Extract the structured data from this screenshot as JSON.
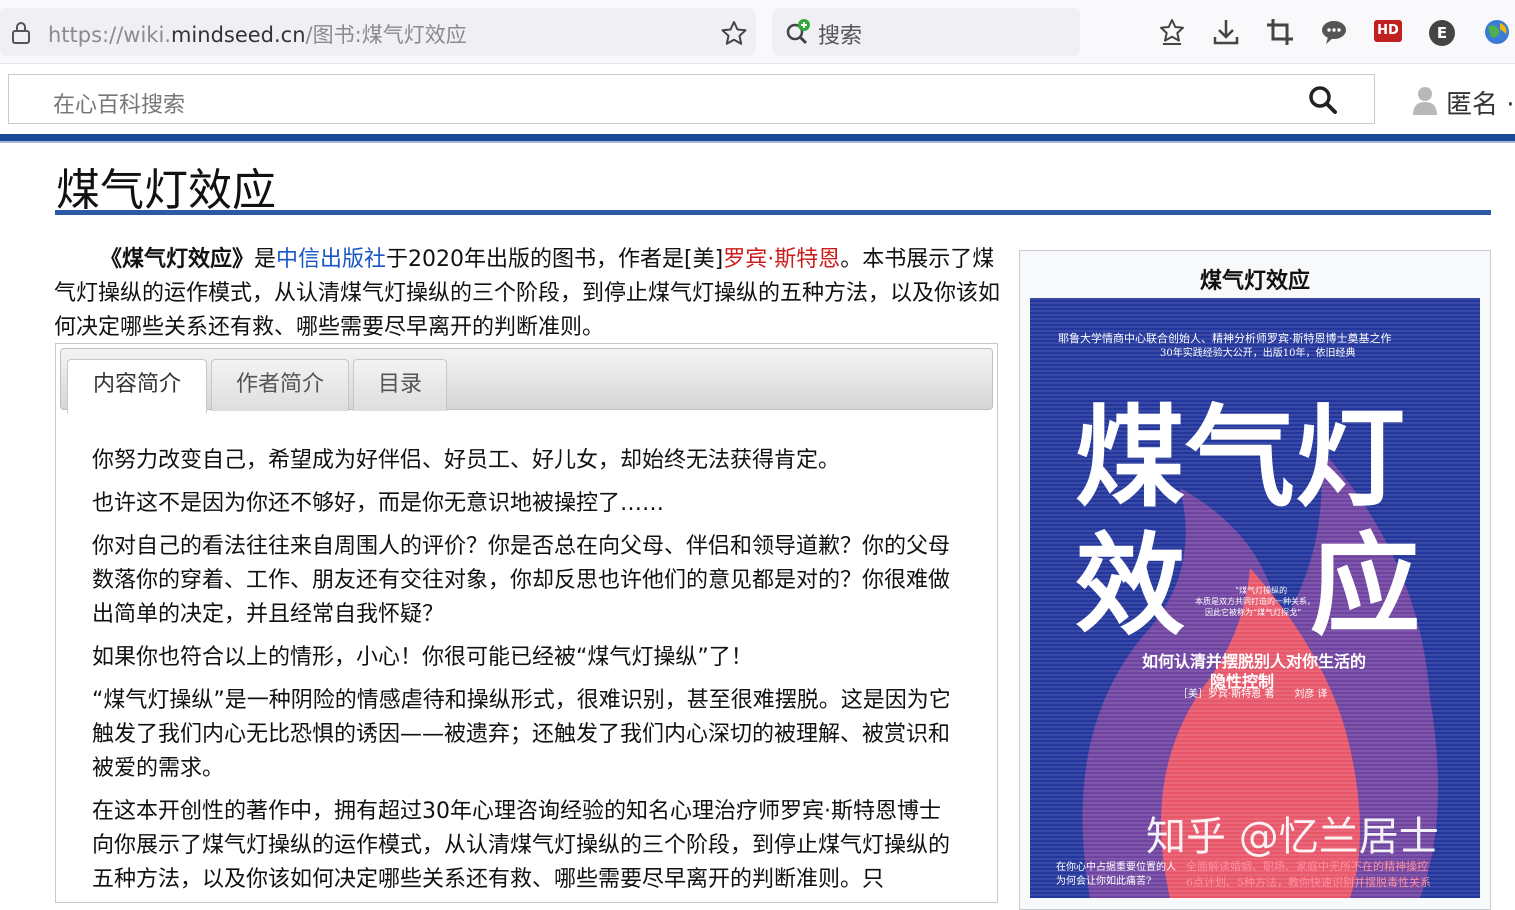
{
  "browser": {
    "url_prefix": "https://wiki.",
    "url_domain": "mindseed.cn",
    "url_path": "/图书:煤气灯效应",
    "search_placeholder": "搜索",
    "toolbar_icons": [
      "favorites-icon",
      "download-icon",
      "crop-icon",
      "chat-icon",
      "hd-icon",
      "extension-e-icon",
      "globe-icon"
    ],
    "hd_label": "HD",
    "e_label": "E"
  },
  "wiki": {
    "search_placeholder": "在心百科搜索",
    "user_label": "匿名 ·"
  },
  "article": {
    "title": "煤气灯效应",
    "intro": {
      "book_title": "《煤气灯效应》",
      "t1": "是",
      "publisher": "中信出版社",
      "t2": "于2020年出版的图书，作者是[美]",
      "author": "罗宾·斯特恩",
      "t3": "。本书展示了煤气灯操纵的运作模式，从认清煤气灯操纵的三个阶段，到停止煤气灯操纵的五种方法，以及你该如何决定哪些关系还有救、哪些需要尽早离开的判断准则。"
    },
    "tabs": [
      "内容简介",
      "作者简介",
      "目录"
    ],
    "content_paragraphs": [
      "你努力改变自己，希望成为好伴侣、好员工、好儿女，却始终无法获得肯定。",
      "也许这不是因为你还不够好，而是你无意识地被操控了……",
      "你对自己的看法往往来自周围人的评价？你是否总在向父母、伴侣和领导道歉？你的父母数落你的穿着、工作、朋友还有交往对象，你却反思也许他们的意见都是对的？你很难做出简单的决定，并且经常自我怀疑？",
      "如果你也符合以上的情形，小心！你很可能已经被“煤气灯操纵”了！",
      "“煤气灯操纵”是一种阴险的情感虐待和操纵形式，很难识别，甚至很难摆脱。这是因为它触发了我们内心无比恐惧的诱因——被遗弃；还触发了我们内心深切的被理解、被赏识和被爱的需求。",
      "在这本开创性的著作中，拥有超过30年心理咨询经验的知名心理治疗师罗宾·斯特恩博士向你展示了煤气灯操纵的运作模式，从认清煤气灯操纵的三个阶段，到停止煤气灯操纵的五种方法，以及你该如何决定哪些关系还有救、哪些需要尽早离开的判断准则。只"
    ]
  },
  "infobox": {
    "title": "煤气灯效应",
    "cover": {
      "top_line1": "耶鲁大学情商中心联合创始人、精神分析师罗宾·斯特恩博士奠基之作",
      "top_line2": "30年实践经验大公开，出版10年，依旧经典",
      "big_title_row1": "煤气灯",
      "big_title_row2a": "效",
      "big_title_row2b": "应",
      "small_line1": "“煤气灯操纵的",
      "small_line2": "本质是双方共同打造的一种关系，",
      "small_line3": "因此它被称为“煤气灯探戈”",
      "subtitle1": "如何认清并摆脱别人对你生活的",
      "subtitle2": "隐性控制",
      "byline": "［美］罗宾·斯特恩 著　　刘彦 译",
      "watermark": "知乎 @忆兰居士",
      "bottom_left1": "在你心中占据重要位置的人",
      "bottom_left2": "为何会让你如此痛苦?",
      "bottom_right1": "全面解读婚姻、职场、家庭中无所不在的精神操控",
      "bottom_right2": "6点计划、5种方法，教你快速识别并摆脱毒性关系",
      "colors": {
        "background": "#22369c",
        "flame": "#e8566a",
        "stripes": "#ffffff"
      }
    }
  }
}
